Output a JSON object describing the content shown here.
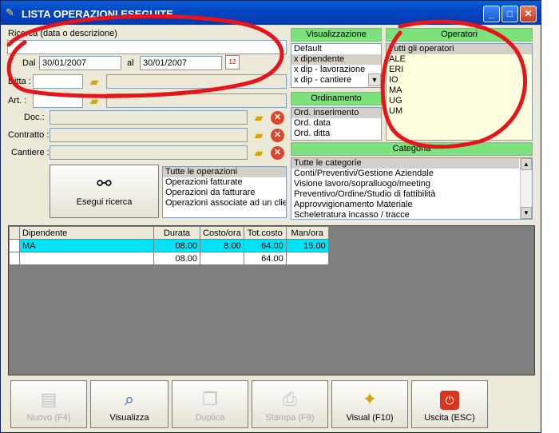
{
  "window": {
    "title": "LISTA OPERAZIONI ESEGUITE",
    "min_label": "_",
    "max_label": "□",
    "close_label": "✕"
  },
  "search": {
    "label": "Ricerca (data o descrizione)",
    "value": "",
    "date_check": "✓",
    "dal_label": "Dal",
    "dal_value": "30/01/2007",
    "al_label": "al",
    "al_value": "30/01/2007",
    "ditta_label": "Ditta :",
    "art_label": "Art. :",
    "doc_label": "Doc.:",
    "contratto_label": "Contratto :",
    "cantiere_label": "Cantiere :",
    "calendar_label": "12",
    "clear_label": "✕",
    "run_label": "Esegui ricerca"
  },
  "operations_filter": {
    "items": [
      "Tutte le operazioni",
      "Operazioni fatturate",
      "Operazioni da fatturare",
      "Operazioni associate ad un clier"
    ]
  },
  "visualizzazione": {
    "header": "Visualizzazione",
    "items": [
      "Default",
      "x dipendente",
      "x dip - lavorazione",
      "x dip - cantiere"
    ]
  },
  "ordinamento": {
    "header": "Ordinamento",
    "items": [
      "Ord. inserimento",
      "Ord. data",
      "Ord. ditta"
    ]
  },
  "operatori": {
    "header": "Operatori",
    "items": [
      "Tutti gli operatori",
      "ALE",
      "ERI",
      "IO",
      "MA",
      "UG",
      "UM"
    ]
  },
  "categoria": {
    "header": "Categoria",
    "items": [
      "Tutte le categorie",
      "Conti/Preventivi/Gestione Aziendale",
      "Visione lavoro/sopralluogo/meeting",
      "Preventivo/Ordine/Studio di fattibilità",
      "Approvvigionamento Materiale",
      "Scheletratura incasso / tracce"
    ]
  },
  "results": {
    "columns": [
      "Dipendente",
      "Durata",
      "Costo/ora",
      "Tot.costo",
      "Man/ora"
    ],
    "rows": [
      [
        "MA",
        "08.00",
        "8.00",
        "64.00",
        "15.00"
      ],
      [
        "",
        "08.00",
        "",
        "64.00",
        ""
      ]
    ]
  },
  "toolbar": {
    "nuovo": "Nuovo (F4)",
    "visualizza": "Visualizza",
    "duplica": "Duplica",
    "stampa": "Stampa (F9)",
    "visual": "Visual (F10)",
    "uscita": "Uscita (ESC)"
  },
  "colors": {
    "panel_header": "#7ce37c",
    "selected_row": "#00e2f5",
    "annotation": "#e8141a"
  }
}
